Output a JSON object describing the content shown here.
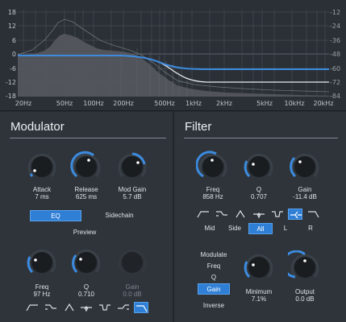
{
  "graph": {
    "db_labels_left": [
      "18",
      "12",
      "6",
      "0",
      "-6",
      "-12",
      "-18"
    ],
    "db_labels_right": [
      "-12",
      "-24",
      "-36",
      "-48",
      "-60",
      "-72",
      "-84"
    ],
    "freq_labels": [
      "20Hz",
      "50Hz",
      "100Hz",
      "200Hz",
      "500Hz",
      "1kHz",
      "2kHz",
      "5kHz",
      "10kHz",
      "20kHz"
    ],
    "curve_color": "#3c8be0",
    "accent": "#2f7fd6"
  },
  "modulator": {
    "title": "Modulator",
    "knobs": {
      "attack": {
        "label": "Attack",
        "value": "7 ms"
      },
      "release": {
        "label": "Release",
        "value": "625 ms"
      },
      "mod_gain": {
        "label": "Mod Gain",
        "value": "5.7 dB"
      },
      "freq": {
        "label": "Freq",
        "value": "97 Hz"
      },
      "q": {
        "label": "Q",
        "value": "0.710"
      },
      "gain": {
        "label": "Gain",
        "value": "0.0 dB"
      }
    },
    "mode": {
      "eq": "EQ",
      "sidechain": "Sidechain"
    },
    "preview": "Preview"
  },
  "filter": {
    "title": "Filter",
    "knobs": {
      "freq": {
        "label": "Freq",
        "value": "858 Hz"
      },
      "q": {
        "label": "Q",
        "value": "0.707"
      },
      "gain": {
        "label": "Gain",
        "value": "-11.4 dB"
      },
      "minimum": {
        "label": "Minimum",
        "value": "7.1%"
      },
      "output": {
        "label": "Output",
        "value": "0.0 dB"
      }
    },
    "channels": [
      "Mid",
      "Side",
      "All",
      "L",
      "R"
    ],
    "modulate": {
      "title": "Modulate",
      "freq": "Freq",
      "q": "Q",
      "gain": "Gain",
      "inverse": "Inverse"
    }
  }
}
